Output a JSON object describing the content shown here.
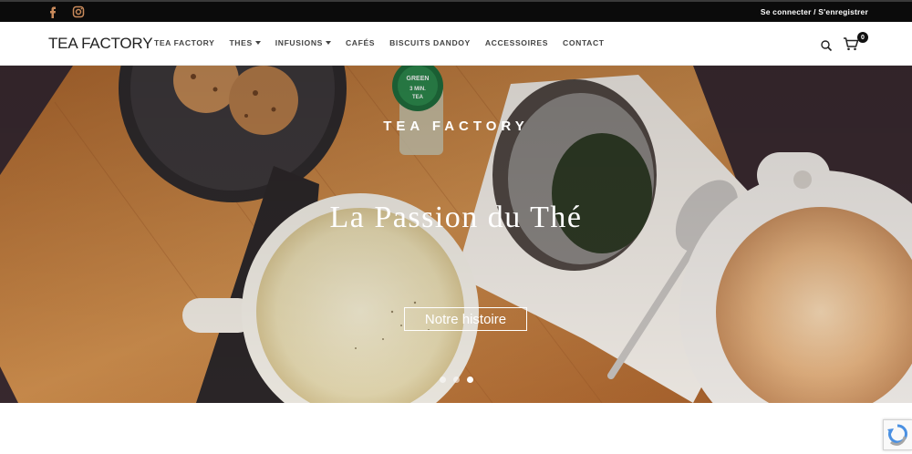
{
  "topbar": {
    "social_icons": [
      "facebook-icon",
      "instagram-icon"
    ],
    "auth_label": "Se connecter / S'enregistrer",
    "colors": {
      "background": "#0b0b0b",
      "icon": "#c98a5b"
    }
  },
  "header": {
    "logo_part1": "TEA",
    "logo_part2": "FACTORY",
    "nav": [
      {
        "label": "TEA FACTORY",
        "dropdown": false
      },
      {
        "label": "THES",
        "dropdown": true
      },
      {
        "label": "INFUSIONS",
        "dropdown": true
      },
      {
        "label": "CAFÉS",
        "dropdown": false
      },
      {
        "label": "BISCUITS DANDOY",
        "dropdown": false
      },
      {
        "label": "ACCESSOIRES",
        "dropdown": false
      },
      {
        "label": "CONTACT",
        "dropdown": false
      }
    ],
    "cart_count": "0"
  },
  "hero": {
    "eyebrow": "TEA FACTORY",
    "headline": "La Passion du Thé",
    "cta": "Notre histoire",
    "slides_total": 3,
    "active_slide": 3,
    "jar_label": "GREEN 3 MIN. TEA"
  }
}
